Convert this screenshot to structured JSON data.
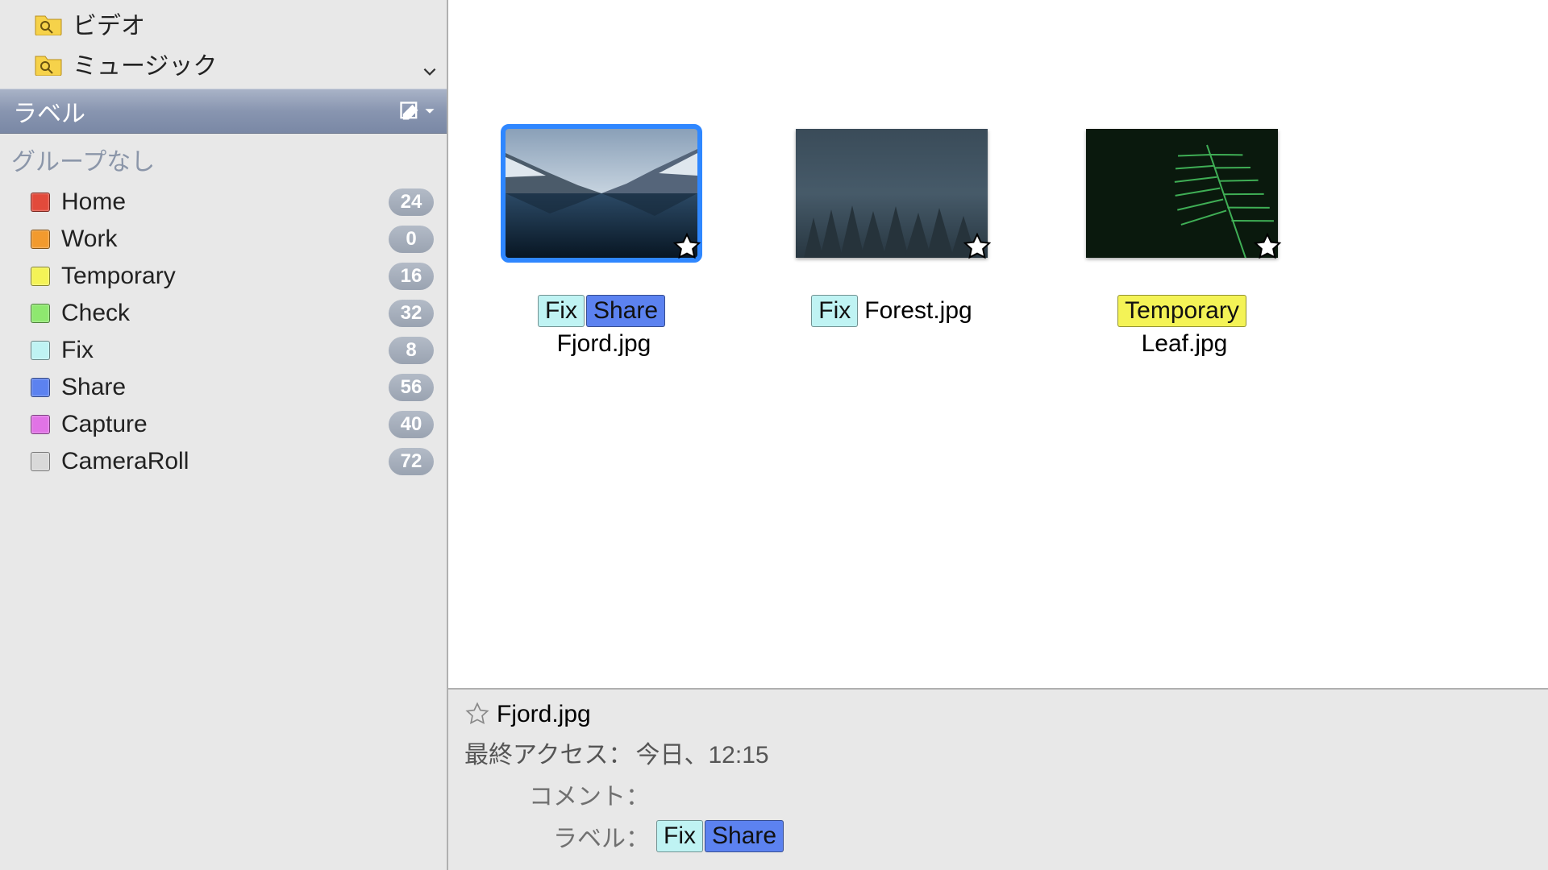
{
  "sidebar": {
    "folders": [
      {
        "label": "ビデオ"
      },
      {
        "label": "ミュージック"
      }
    ],
    "label_header": "ラベル",
    "group_head": "グループなし",
    "labels": [
      {
        "name": "Home",
        "color": "#e24a3b",
        "count": 24
      },
      {
        "name": "Work",
        "color": "#f29a2e",
        "count": 0
      },
      {
        "name": "Temporary",
        "color": "#f4f356",
        "count": 16
      },
      {
        "name": "Check",
        "color": "#8ee86f",
        "count": 32
      },
      {
        "name": "Fix",
        "color": "#bff3f3",
        "count": 8
      },
      {
        "name": "Share",
        "color": "#5c82f0",
        "count": 56
      },
      {
        "name": "Capture",
        "color": "#e173e6",
        "count": 40
      },
      {
        "name": "CameraRoll",
        "color": "#d9d9d9",
        "count": 72
      }
    ]
  },
  "thumbs": [
    {
      "filename": "Fjord.jpg",
      "selected": true,
      "tags": [
        {
          "text": "Fix",
          "bg": "#bff3f3"
        },
        {
          "text": "Share",
          "bg": "#5c82f0"
        }
      ]
    },
    {
      "filename": "Forest.jpg",
      "selected": false,
      "tags": [
        {
          "text": "Fix",
          "bg": "#bff3f3"
        }
      ]
    },
    {
      "filename": "Leaf.jpg",
      "selected": false,
      "tags": [
        {
          "text": "Temporary",
          "bg": "#f4f356"
        }
      ]
    }
  ],
  "details": {
    "filename": "Fjord.jpg",
    "access_key": "最終アクセス：",
    "access_val": "今日、12:15",
    "comment_key": "コメント：",
    "comment_val": "",
    "label_key": "ラベル：",
    "tags": [
      {
        "text": "Fix",
        "bg": "#bff3f3"
      },
      {
        "text": "Share",
        "bg": "#5c82f0"
      }
    ]
  },
  "colors": {
    "folder_fill": "#f6d24a",
    "folder_glass": "#9c7a12"
  }
}
